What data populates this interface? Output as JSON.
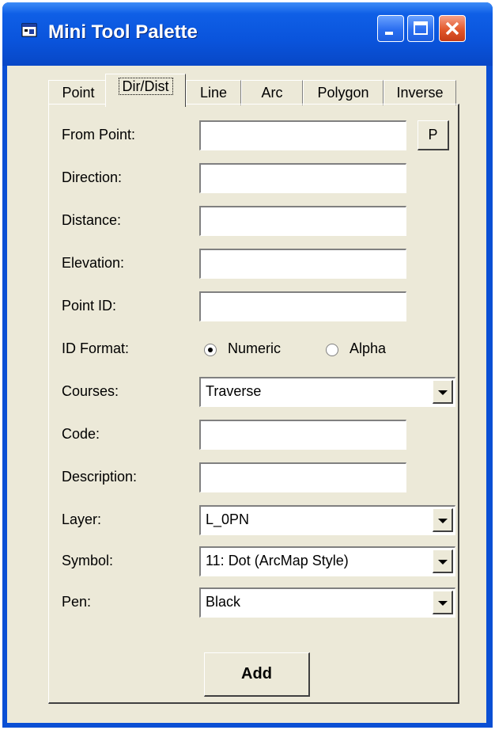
{
  "window": {
    "title": "Mini Tool Palette"
  },
  "tabs": [
    {
      "label": "Point"
    },
    {
      "label": "Dir/Dist",
      "active": true
    },
    {
      "label": "Line"
    },
    {
      "label": "Arc"
    },
    {
      "label": "Polygon"
    },
    {
      "label": "Inverse"
    }
  ],
  "form": {
    "from_point": {
      "label": "From Point:",
      "value": "",
      "button": "P"
    },
    "direction": {
      "label": "Direction:",
      "value": ""
    },
    "distance": {
      "label": "Distance:",
      "value": ""
    },
    "elevation": {
      "label": "Elevation:",
      "value": ""
    },
    "point_id": {
      "label": "Point ID:",
      "value": ""
    },
    "id_format": {
      "label": "ID Format:",
      "options": [
        "Numeric",
        "Alpha"
      ],
      "selected": "Numeric"
    },
    "courses": {
      "label": "Courses:",
      "value": "Traverse"
    },
    "code": {
      "label": "Code:",
      "value": ""
    },
    "description": {
      "label": "Description:",
      "value": ""
    },
    "layer": {
      "label": "Layer:",
      "value": "L_0PN"
    },
    "symbol": {
      "label": "Symbol:",
      "value": "11: Dot (ArcMap Style)"
    },
    "pen": {
      "label": "Pen:",
      "value": "Black"
    },
    "add_button": "Add"
  },
  "colors": {
    "titlebar": "#0a54dc",
    "client": "#ece9d8",
    "close_button": "#e2582b"
  }
}
